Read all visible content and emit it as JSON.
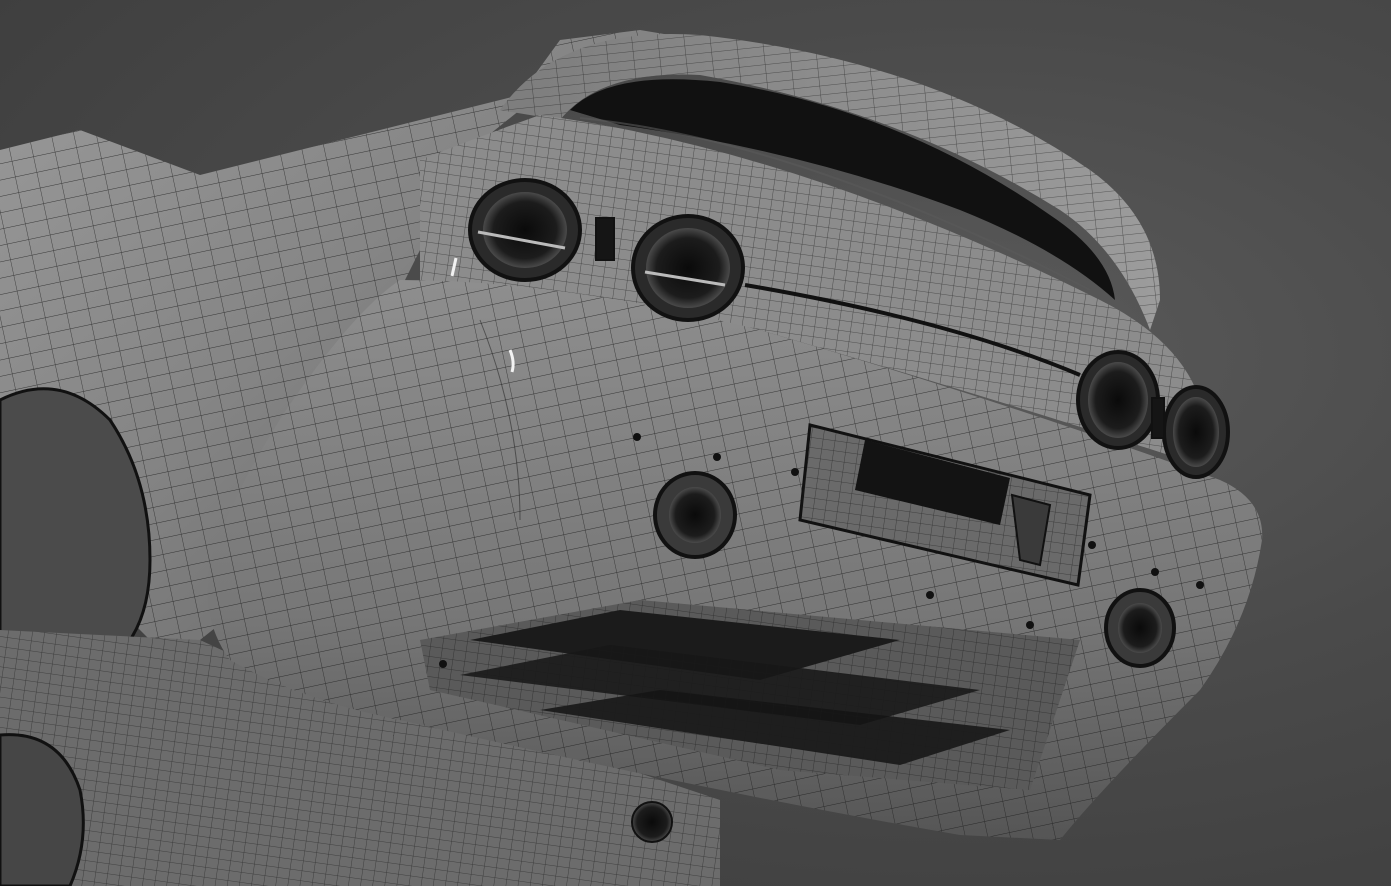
{
  "viewport": {
    "render_mode": "wireframe-on-shaded",
    "subject": "car-rear-bumper-mesh",
    "background_color": "#454545",
    "surface_color": "#8a8a8a",
    "wire_color": "#1a1a1a",
    "cavity_color": "#0c0c0c"
  }
}
